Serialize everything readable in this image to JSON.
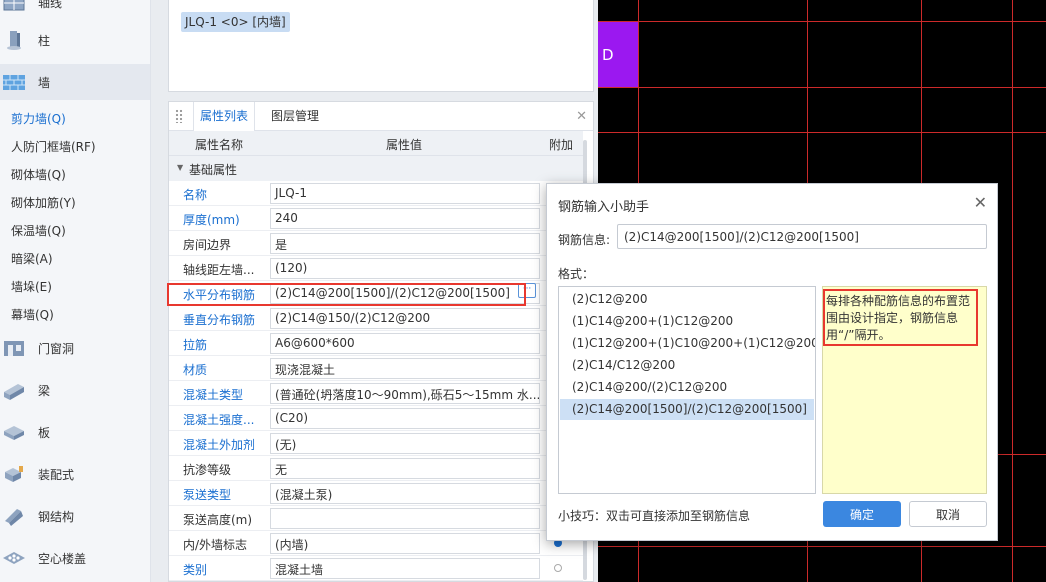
{
  "nav": {
    "top_partial": "轴线",
    "categories": [
      {
        "label": "柱",
        "icon": "column-icon"
      },
      {
        "label": "墙",
        "icon": "wall-icon"
      },
      {
        "label": "门窗洞",
        "icon": "door-window-icon"
      },
      {
        "label": "梁",
        "icon": "beam-icon"
      },
      {
        "label": "板",
        "icon": "slab-icon"
      },
      {
        "label": "装配式",
        "icon": "prefab-icon"
      },
      {
        "label": "钢结构",
        "icon": "steel-structure-icon"
      },
      {
        "label": "空心楼盖",
        "icon": "hollow-floor-icon"
      }
    ],
    "wall_items": [
      "剪力墙(Q)",
      "人防门框墙(RF)",
      "砌体墙(Q)",
      "砌体加筋(Y)",
      "保温墙(Q)",
      "暗梁(A)",
      "墙垛(E)",
      "幕墙(Q)"
    ],
    "active_category": "墙",
    "active_item": "剪力墙(Q)"
  },
  "upper_panel": {
    "tag": "JLQ-1 <0> [内墙]"
  },
  "props_panel": {
    "tabs": [
      "属性列表",
      "图层管理"
    ],
    "active_tab": "属性列表",
    "headers": {
      "name": "属性名称",
      "value": "属性值",
      "extra": "附加"
    },
    "group": "基础属性",
    "rows": [
      {
        "name": "名称",
        "value": "JLQ-1",
        "blue": true,
        "extra": ""
      },
      {
        "name": "厚度(mm)",
        "value": "240",
        "blue": true,
        "extra": ""
      },
      {
        "name": "房间边界",
        "value": "是",
        "blue": false,
        "extra": ""
      },
      {
        "name": "轴线距左墙...",
        "value": "(120)",
        "blue": false,
        "extra": ""
      },
      {
        "name": "水平分布钢筋",
        "value": "(2)C14@200[1500]/(2)C12@200[1500]",
        "blue": true,
        "extra": "",
        "highlight": true
      },
      {
        "name": "垂直分布钢筋",
        "value": "(2)C14@150/(2)C12@200",
        "blue": true,
        "extra": ""
      },
      {
        "name": "拉筋",
        "value": "A6@600*600",
        "blue": true,
        "extra": ""
      },
      {
        "name": "材质",
        "value": "现浇混凝土",
        "blue": true,
        "extra": ""
      },
      {
        "name": "混凝土类型",
        "value": "(普通砼(坍落度10～90mm),砾石5～15mm 水...",
        "blue": true,
        "extra": ""
      },
      {
        "name": "混凝土强度...",
        "value": "(C20)",
        "blue": true,
        "extra": ""
      },
      {
        "name": "混凝土外加剂",
        "value": "(无)",
        "blue": true,
        "extra": ""
      },
      {
        "name": "抗渗等级",
        "value": "无",
        "blue": false,
        "extra": ""
      },
      {
        "name": "泵送类型",
        "value": "(混凝土泵)",
        "blue": true,
        "extra": ""
      },
      {
        "name": "泵送高度(m)",
        "value": "",
        "blue": false,
        "extra": ""
      },
      {
        "name": "内/外墙标志",
        "value": "(内墙)",
        "blue": false,
        "extra": "radio-on"
      },
      {
        "name": "类别",
        "value": "混凝土墙",
        "blue": true,
        "extra": "radio-off"
      }
    ]
  },
  "canvas": {
    "marker_label": "D"
  },
  "dialog": {
    "title": "钢筋输入小助手",
    "info_label": "钢筋信息:",
    "info_value": "(2)C14@200[1500]/(2)C12@200[1500]",
    "format_label": "格式：",
    "formats": [
      "(2)C12@200",
      "(1)C14@200+(1)C12@200",
      "(1)C12@200+(1)C10@200+(1)C12@200",
      "(2)C14/C12@200",
      "(2)C14@200/(2)C12@200",
      "(2)C14@200[1500]/(2)C12@200[1500]"
    ],
    "selected_format": "(2)C14@200[1500]/(2)C12@200[1500]",
    "note": "每排各种配筋信息的布置范围由设计指定，钢筋信息用“/”隔开。",
    "tip": "小技巧：双击可直接添加至钢筋信息",
    "ok": "确定",
    "cancel": "取消"
  },
  "colors": {
    "accent": "#1a6fd0",
    "highlight_border": "#e8382f",
    "grid_line": "#cc2a2a",
    "marker": "#9b18f0",
    "note_bg": "#ffffcb",
    "primary_button": "#3b87e0"
  }
}
